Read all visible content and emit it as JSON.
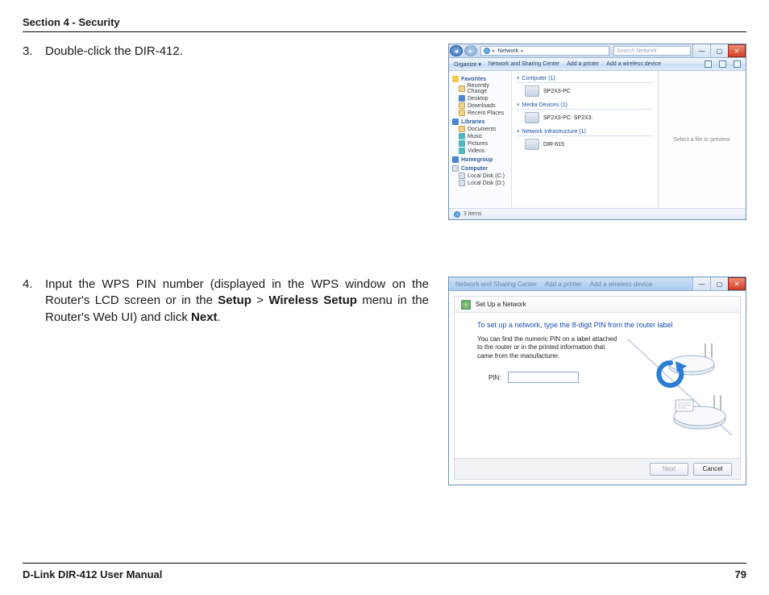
{
  "header": {
    "section": "Section 4 - Security"
  },
  "footer": {
    "manual": "D-Link DIR-412 User Manual",
    "page": "79"
  },
  "step3": {
    "num": "3.",
    "text": "Double-click the DIR-412."
  },
  "step4": {
    "num": "4.",
    "t1": "Input the WPS PIN number (displayed in the WPS window on the Router's LCD screen or in the ",
    "b1": "Setup",
    "t2": " > ",
    "b2": "Wireless Setup",
    "t3": " menu in the Router's Web UI) and click ",
    "b3": "Next",
    "t4": "."
  },
  "explorer": {
    "addr1": "Network",
    "addr_sep": "▸",
    "search_placeholder": "Search Network",
    "cmd": {
      "organize": "Organize ▾",
      "nsc": "Network and Sharing Center",
      "addprinter": "Add a printer",
      "addwifi": "Add a wireless device"
    },
    "nav": {
      "favorites": "Favorites",
      "recent": "Recently Change",
      "desktop": "Desktop",
      "downloads": "Downloads",
      "recentplaces": "Recent Places",
      "libraries": "Libraries",
      "documents": "Documents",
      "music": "Music",
      "pictures": "Pictures",
      "videos": "Videos",
      "homegroup": "Homegroup",
      "computer": "Computer",
      "cdrive": "Local Disk (C:)",
      "ddrive": "Local Disk (D:)"
    },
    "groups": {
      "g1": "Computer (1)",
      "g1i": "SP2X3-PC",
      "g2": "Media Devices (1)",
      "g2i": "SP2X3-PC: SP2X3:",
      "g3": "Network Infrastructure (1)",
      "g3i": "DIR-615"
    },
    "preview": "Select a file to preview.",
    "status": "3 items"
  },
  "wps": {
    "behind1": "Network and Sharing Center",
    "behind2": "Add a printer",
    "behind3": "Add a wireless device",
    "title": "Set Up a Network",
    "instr": "To set up a network, type the 8-digit PIN from the router label",
    "sub": "You can find the numeric PIN on a label attached to the router or in the printed information that came from the manufacturer.",
    "pin_label": "PIN:",
    "next": "Next",
    "cancel": "Cancel"
  }
}
